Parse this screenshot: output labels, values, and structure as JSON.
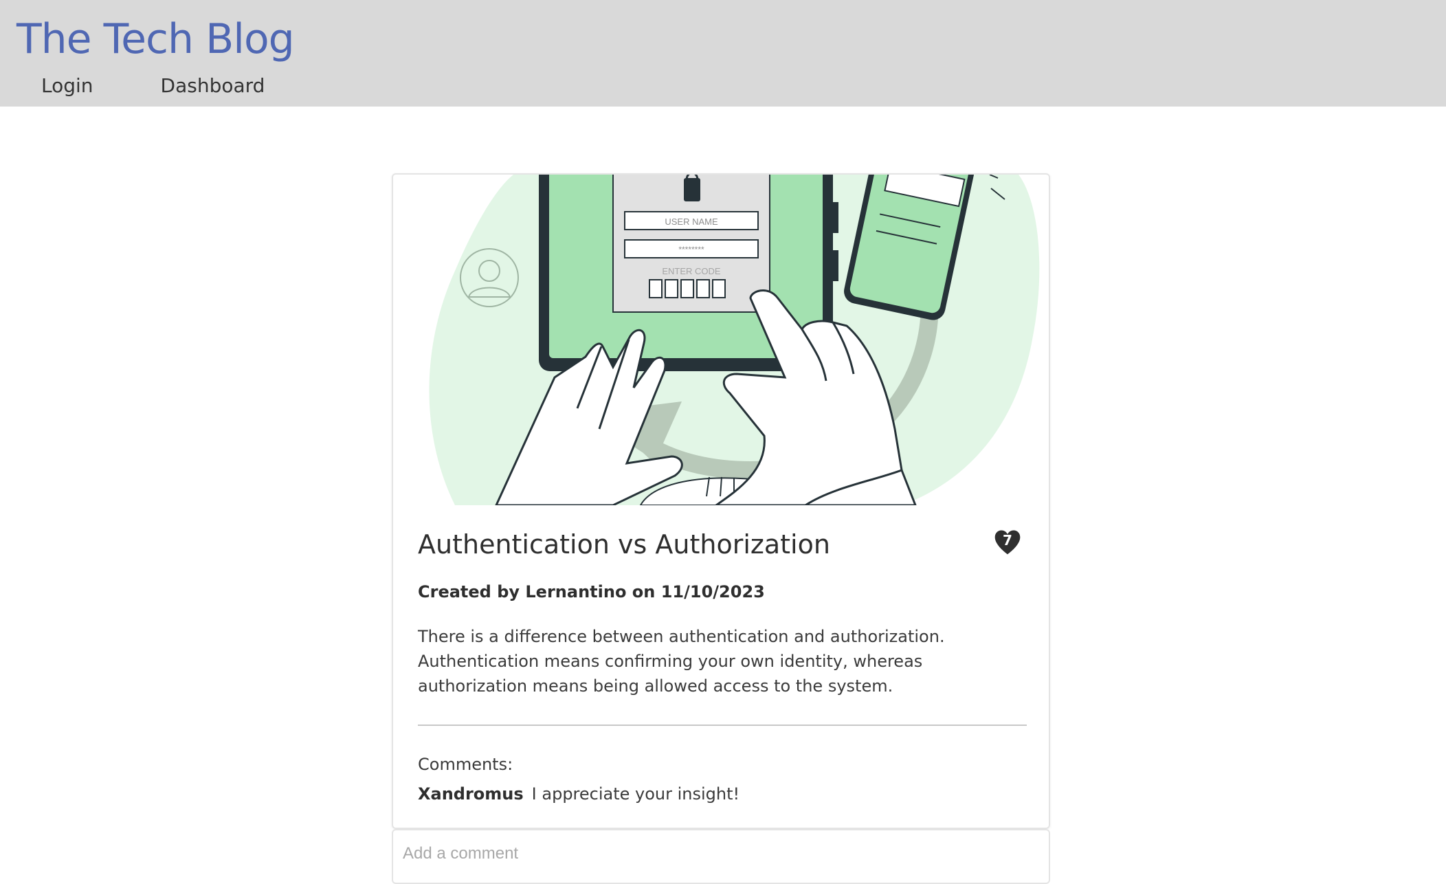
{
  "header": {
    "title": "The Tech Blog",
    "nav": [
      {
        "label": "Login"
      },
      {
        "label": "Dashboard"
      }
    ]
  },
  "post": {
    "title": "Authentication vs Authorization",
    "likes": "7",
    "byline": "Created by Lernantino on 11/10/2023",
    "content": "There is a difference between authentication and authorization. Authentication means confirming your own identity, whereas authorization means being allowed access to the system.",
    "image": {
      "username_placeholder": "USER NAME",
      "password_placeholder": "********",
      "enter_code_label": "ENTER CODE"
    }
  },
  "comments": {
    "label": "Comments:",
    "items": [
      {
        "author": "Xandromus",
        "text": "I appreciate your insight!"
      }
    ]
  },
  "comment_form": {
    "placeholder": "Add a comment"
  },
  "colors": {
    "header_bg": "#d9d9d9",
    "title_blue": "#4f67b3",
    "illustration_green": "#a3e1b0",
    "illustration_light_green": "#e2f6e6"
  }
}
